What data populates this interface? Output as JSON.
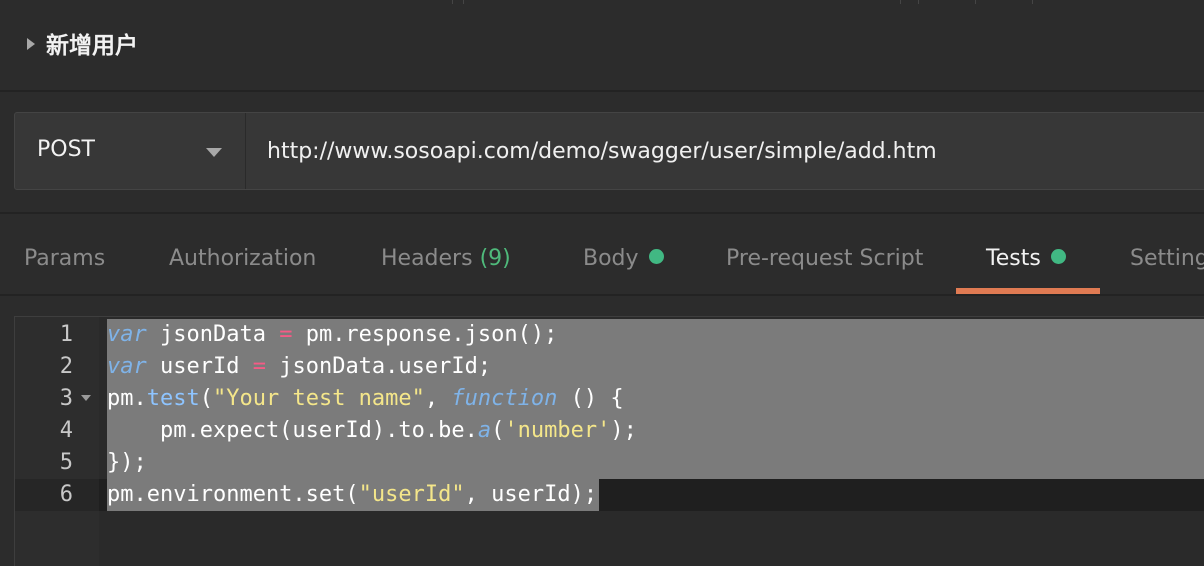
{
  "request": {
    "name": "新增用户",
    "method": "POST",
    "url": "http://www.sosoapi.com/demo/swagger/user/simple/add.htm"
  },
  "tabs": [
    {
      "label": "Params"
    },
    {
      "label": "Authorization"
    },
    {
      "label": "Headers",
      "count": "(9)"
    },
    {
      "label": "Body",
      "indicator": "green-dot"
    },
    {
      "label": "Pre-request Script"
    },
    {
      "label": "Tests",
      "indicator": "green-dot",
      "active": true
    },
    {
      "label": "Setting"
    }
  ],
  "editor": {
    "line_numbers": [
      "1",
      "2",
      "3",
      "4",
      "5",
      "6"
    ],
    "code": [
      [
        {
          "t": "var",
          "c": "kw"
        },
        {
          "t": " jsonData "
        },
        {
          "t": "=",
          "c": "op"
        },
        {
          "t": " pm.response.json();"
        }
      ],
      [
        {
          "t": "var",
          "c": "kw"
        },
        {
          "t": " userId "
        },
        {
          "t": "=",
          "c": "op"
        },
        {
          "t": " jsonData.userId;"
        }
      ],
      [
        {
          "t": "pm."
        },
        {
          "t": "test",
          "c": "fn"
        },
        {
          "t": "("
        },
        {
          "t": "\"Your test name\"",
          "c": "str"
        },
        {
          "t": ", "
        },
        {
          "t": "function",
          "c": "kw"
        },
        {
          "t": " () {"
        }
      ],
      [
        {
          "t": "    pm.expect(userId).to.be."
        },
        {
          "t": "a",
          "c": "kw"
        },
        {
          "t": "("
        },
        {
          "t": "'number'",
          "c": "str"
        },
        {
          "t": ");"
        }
      ],
      [
        {
          "t": "});"
        }
      ],
      [
        {
          "t": "pm.environment.set("
        },
        {
          "t": "\"userId\"",
          "c": "str"
        },
        {
          "t": ", userId);"
        }
      ]
    ]
  },
  "colors": {
    "tab_underline": "#e07b53",
    "indicator_dot": "#41b883",
    "selection": "#7b7b7b"
  }
}
